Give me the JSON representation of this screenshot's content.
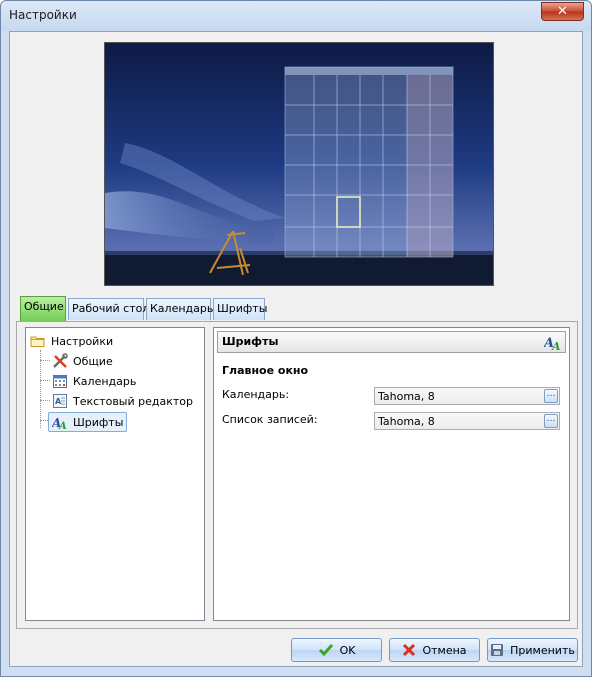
{
  "window": {
    "title": "Настройки",
    "close_icon": "close-icon"
  },
  "tabs": [
    {
      "label": "Общие",
      "active": true
    },
    {
      "label": "Рабочий стол",
      "active": false
    },
    {
      "label": "Календарь",
      "active": false
    },
    {
      "label": "Шрифты",
      "active": false
    }
  ],
  "tree": {
    "root": {
      "label": "Настройки",
      "icon": "folder-icon"
    },
    "items": [
      {
        "label": "Общие",
        "icon": "tools-icon"
      },
      {
        "label": "Календарь",
        "icon": "calendar-icon"
      },
      {
        "label": "Текстовый редактор",
        "icon": "text-editor-icon"
      },
      {
        "label": "Шрифты",
        "icon": "fonts-icon",
        "selected": true
      }
    ]
  },
  "pane": {
    "title": "Шрифты",
    "section": "Главное окно",
    "rows": [
      {
        "label": "Календарь:",
        "value": "Tahoma, 8"
      },
      {
        "label": "Список записей:",
        "value": "Tahoma, 8"
      }
    ]
  },
  "buttons": {
    "ok": "OK",
    "cancel": "Отмена",
    "apply": "Применить"
  }
}
